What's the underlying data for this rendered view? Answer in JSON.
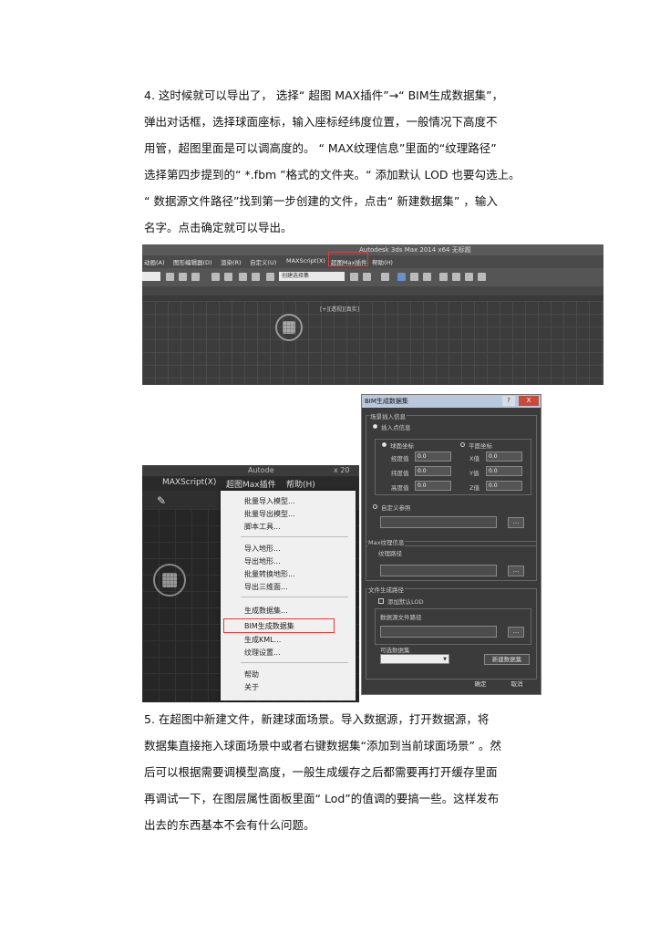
{
  "step4": {
    "lines": [
      "4. 这时候就可以导出了，  选择“  超图  MAX插件”→“  BIM生成数据集”，",
      "弹出对话框，选择球面座标，输入座标经纬度位置，一般情况下高度不",
      "用管，超图里面是可以调高度的。   “  MAX纹理信息”里面的“纹理路径”",
      "选择第四步提到的“  *.fbm ”格式的文件夹。“  添加默认  LOD  也要勾选上。",
      "“  数据源文件路径”找到第一步创建的文件，点击“  新建数据集”       ，输入",
      "名字。点击确定就可以导出。"
    ]
  },
  "step5": {
    "lines": [
      "5. 在超图中新建文件，新建球面场景。导入数据源，打开数据源，将",
      "数据集直接拖入球面场景中或者右键数据集“添加到当前球面场景”     。然",
      "后可以根据需要调模型高度，一般生成缓存之后都需要再打开缓存里面",
      "再调试一下，在图层属性面板里面“     Lod”的值调的要搞一些。这样发布",
      "出去的东西基本不会有什么问题。"
    ]
  },
  "screenshot_top": {
    "app_title": "Autodesk 3ds Max  2014 x64    无标题",
    "menu": [
      "动画(A)",
      "图形编辑器(D)",
      "渲染(R)",
      "自定义(U)",
      "MAXScript(X)",
      "超图Max插件",
      "帮助(H)"
    ],
    "selection_set": "创建选择集",
    "viewport_label": "[+][透视][真实]"
  },
  "screenshot_menu": {
    "app_title": "Autode",
    "app_title_extra": "x 20",
    "menu": [
      "MAXScript(X)",
      "超图Max插件",
      "帮助(H)"
    ],
    "items": [
      "批量导入模型...",
      "批量导出模型...",
      "脚本工具...",
      "导入地形...",
      "导出地形...",
      "批量转换地形...",
      "导出三维面...",
      "生成数据集...",
      "BIM生成数据集",
      "生成KML...",
      "纹理设置...",
      "帮助",
      "关于"
    ]
  },
  "dialog": {
    "title": "BIM生成数据集",
    "help": "?",
    "close": "X",
    "group_scene": "场景插入信息",
    "insert_point": "插入点信息",
    "sphere_coord": "球面坐标",
    "plane_coord": "平面坐标",
    "longitude_label": "经度值",
    "latitude_label": "纬度值",
    "height_label": "高度值",
    "x_label": "X值",
    "y_label": "Y值",
    "z_label": "Z值",
    "longitude_value": "0.0",
    "latitude_value": "0.0",
    "height_value": "0.0",
    "x_value": "0.0",
    "y_value": "0.0",
    "z_value": "0.0",
    "custom_ref": "自定义参照",
    "browse": "...",
    "group_texture": "Max纹理信息",
    "texture_path": "纹理路径",
    "group_output": "文件生成路径",
    "add_lod": "添加默认LOD",
    "source_path": "数据源文件路径",
    "optional_dataset": "可选数据集",
    "new_dataset": "新建数据集",
    "ok": "确定",
    "cancel": "取消"
  }
}
